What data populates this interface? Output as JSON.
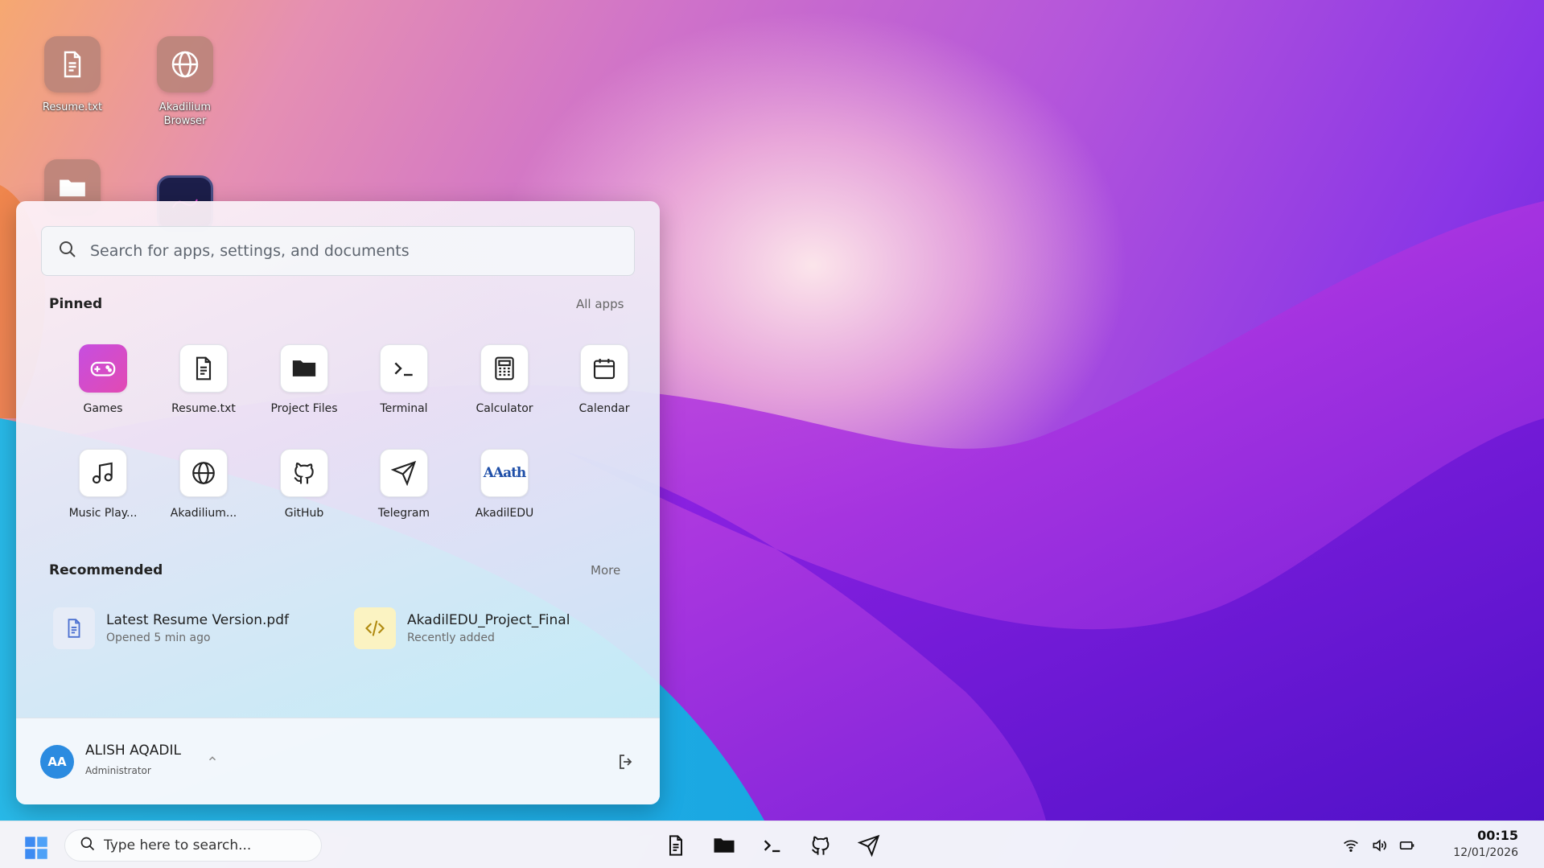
{
  "desktop": {
    "icons": [
      {
        "label": "Resume.txt",
        "icon": "document-icon"
      },
      {
        "label": "Akadilium Browser",
        "icon": "globe-icon"
      },
      {
        "label": "",
        "icon": "folder-icon"
      },
      {
        "label": "",
        "icon": "app-icon"
      }
    ]
  },
  "start_menu": {
    "search_placeholder": "Search for apps, settings, and documents",
    "pinned_title": "Pinned",
    "all_apps": "All apps",
    "pinned": [
      {
        "label": "Games",
        "icon": "gamepad-icon"
      },
      {
        "label": "Resume.txt",
        "icon": "document-icon"
      },
      {
        "label": "Project Files",
        "icon": "folder-icon"
      },
      {
        "label": "Terminal",
        "icon": "terminal-icon"
      },
      {
        "label": "Calculator",
        "icon": "calculator-icon"
      },
      {
        "label": "Calendar",
        "icon": "calendar-icon"
      },
      {
        "label": "Music Play...",
        "icon": "music-icon"
      },
      {
        "label": "Akadilium...",
        "icon": "globe-icon"
      },
      {
        "label": "GitHub",
        "icon": "github-icon"
      },
      {
        "label": "Telegram",
        "icon": "send-icon"
      },
      {
        "label": "AkadilEDU",
        "icon": "akadiledu-icon"
      }
    ],
    "akadiledu_logo_text": "AAath",
    "recommended_title": "Recommended",
    "more": "More",
    "recommended": [
      {
        "title": "Latest Resume Version.pdf",
        "subtitle": "Opened 5 min ago",
        "icon": "document-icon"
      },
      {
        "title": "AkadilEDU_Project_Final",
        "subtitle": "Recently added",
        "icon": "code-icon"
      }
    ],
    "user": {
      "initials": "AA",
      "name": "ALISH AQADIL",
      "role": "Administrator"
    }
  },
  "taskbar": {
    "search_placeholder": "Type here to search...",
    "time": "00:15",
    "date": "12/01/2026"
  },
  "colors": {
    "accent": "#2b8be0",
    "games_tile": "#d04dd2",
    "recommended_doc_bg": "#e6ecf7",
    "recommended_code_bg": "#fbf3c2"
  }
}
